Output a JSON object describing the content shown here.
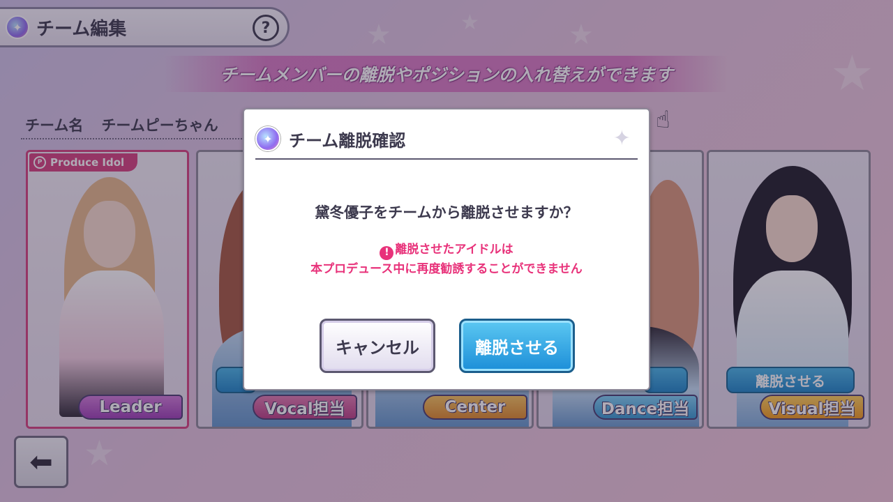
{
  "header": {
    "title": "チーム編集",
    "help_label": "?"
  },
  "banner": {
    "text": "チームメンバーの離脱やポジションの入れ替えができます"
  },
  "team": {
    "name_label": "チーム名",
    "name_value": "チームピーちゃん"
  },
  "cards": [
    {
      "badge": "Produce Idol",
      "role": "Leader"
    },
    {
      "role": "Vocal担当"
    },
    {
      "role": "Center"
    },
    {
      "role": "Dance担当"
    },
    {
      "remove_label": "離脱させる",
      "role": "Visual担当"
    }
  ],
  "dialog": {
    "title": "チーム離脱確認",
    "question": "黛冬優子をチームから離脱させますか？",
    "warning_line1": "離脱させたアイドルは",
    "warning_line2": "本プロデュース中に再度勧誘することができません",
    "warning_icon": "!",
    "cancel_label": "キャンセル",
    "confirm_label": "離脱させる"
  },
  "colors": {
    "accent": "#e8327a",
    "confirm": "#1c8ed8",
    "banner": "#d76ebe"
  },
  "icons": [
    "app-logo-icon",
    "help-icon",
    "hand-pointer-icon",
    "sparkle-icon",
    "warning-icon",
    "back-arrow-icon"
  ]
}
